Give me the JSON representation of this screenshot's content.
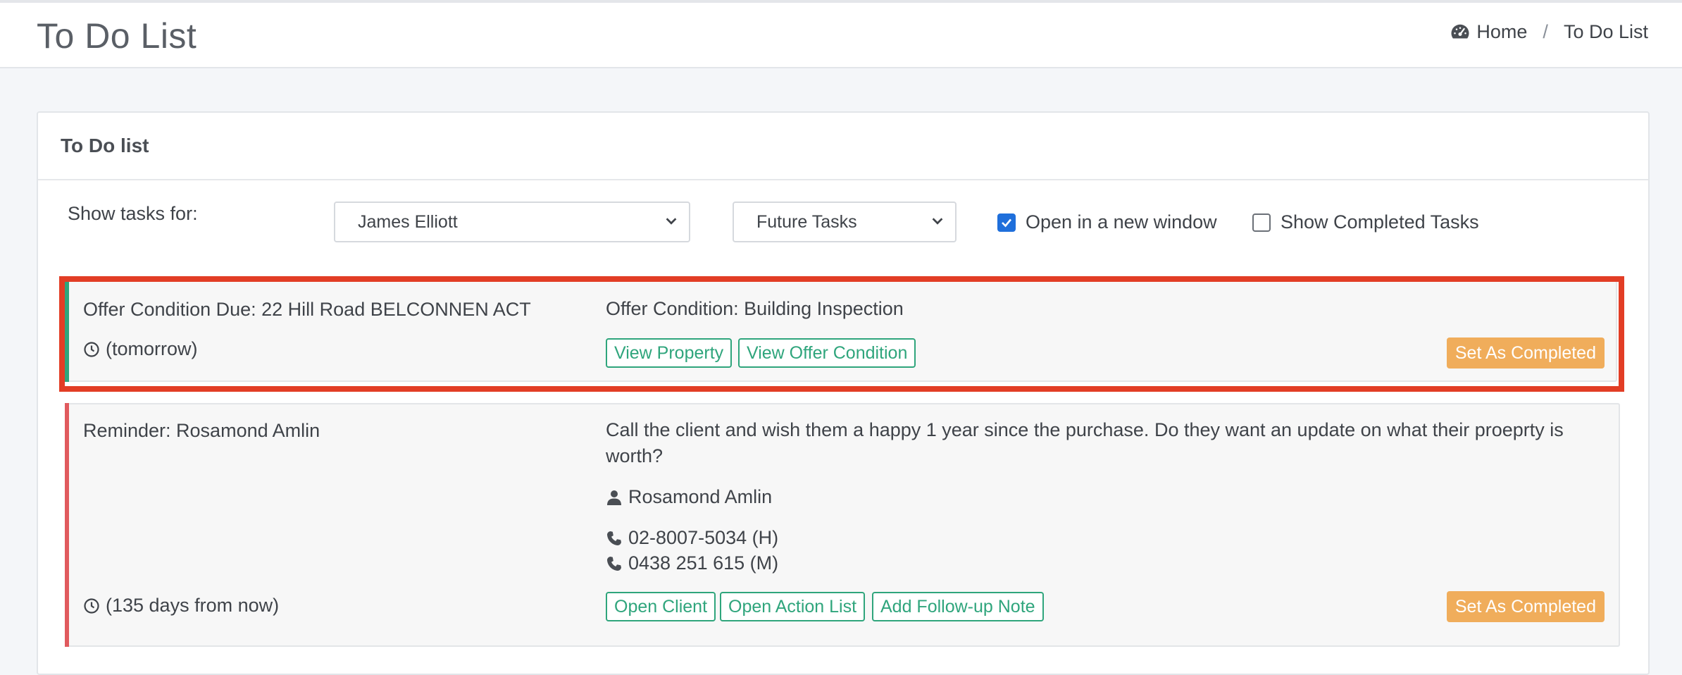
{
  "header": {
    "title": "To Do List",
    "breadcrumb": {
      "home": "Home",
      "separator": "/",
      "current": "To Do List"
    }
  },
  "card": {
    "title": "To Do list"
  },
  "filters": {
    "show_label": "Show tasks for:",
    "user_select": "James Elliott",
    "period_select": "Future Tasks",
    "open_new_window": {
      "label": "Open in a new window",
      "checked": true
    },
    "show_completed": {
      "label": "Show Completed Tasks",
      "checked": false
    }
  },
  "tasks": [
    {
      "title": "Offer Condition Due: 22 Hill Road BELCONNEN ACT",
      "when": "(tomorrow)",
      "description": "Offer Condition: Building Inspection",
      "buttons": [
        "View Property",
        "View Offer Condition"
      ],
      "complete_label": "Set As Completed",
      "accent_color": "#2fa57c"
    },
    {
      "title": "Reminder: Rosamond Amlin",
      "when": "(135 days from now)",
      "description_line1": "Call the client and wish them a happy 1 year since the purchase. Do they want an update on what their proeprty is",
      "description_line2": "worth?",
      "contact_name": "Rosamond Amlin",
      "phone_home": "02-8007-5034 (H)",
      "phone_mobile": "0438 251 615 (M)",
      "buttons": [
        "Open Client",
        "Open Action List",
        "Add Follow-up Note"
      ],
      "complete_label": "Set As Completed",
      "accent_color": "#e05a5e"
    }
  ],
  "icons": {
    "breadcrumb": "dashboard-gauge-icon",
    "time": "clock-icon",
    "person": "user-icon",
    "phone": "phone-icon"
  },
  "colors": {
    "highlight_border": "#e23d25",
    "button_outline": "#2fa57c",
    "complete_button": "#f0ad5b",
    "checkbox": "#1f6fdb"
  }
}
